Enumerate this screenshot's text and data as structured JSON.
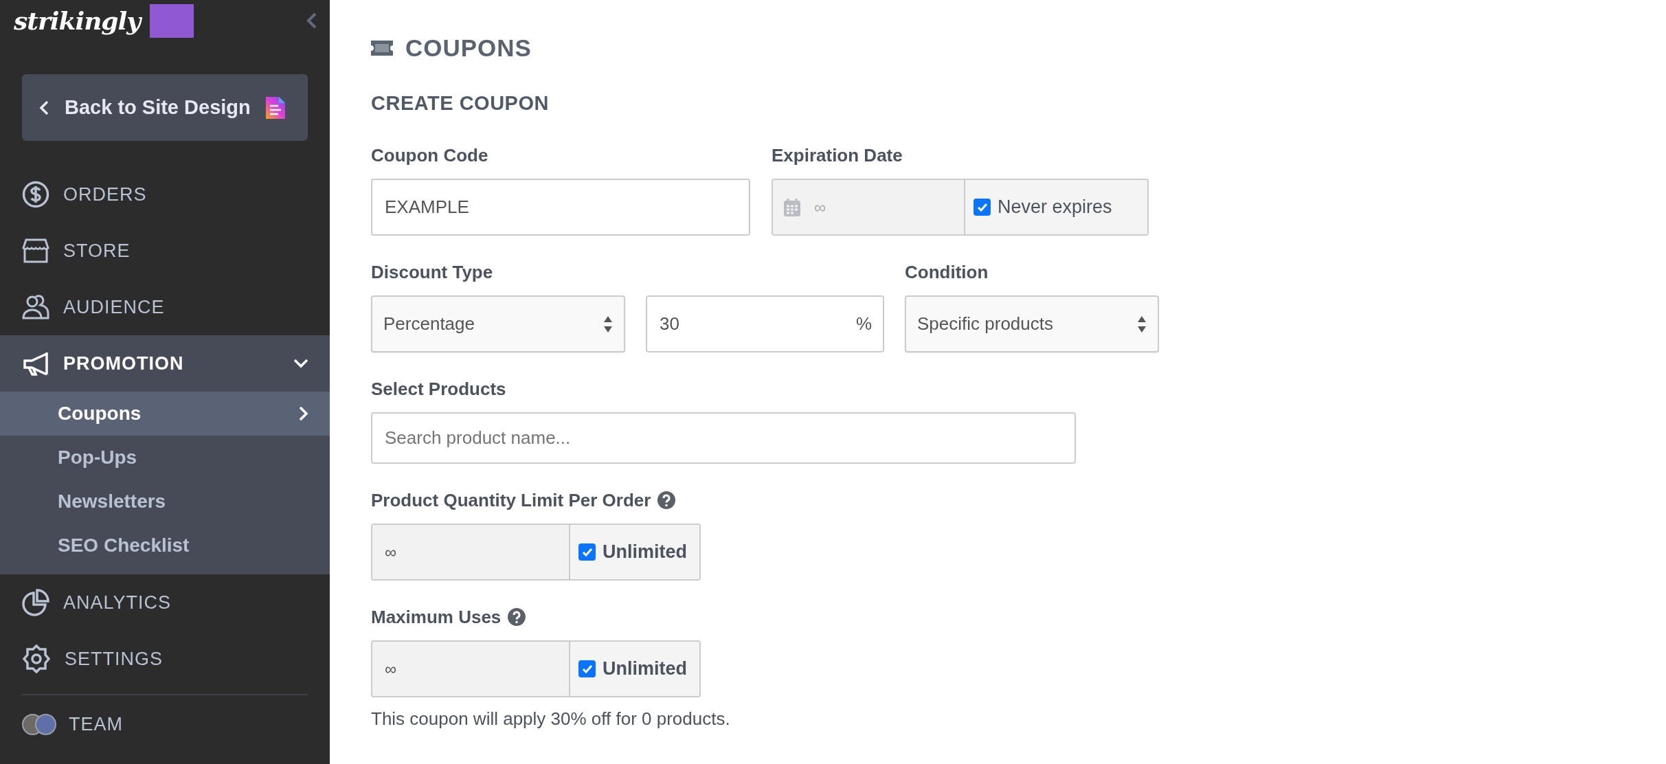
{
  "sidebar": {
    "logo": "strikingly",
    "back_button": "Back to Site Design",
    "nav": [
      {
        "label": "ORDERS"
      },
      {
        "label": "STORE"
      },
      {
        "label": "AUDIENCE"
      },
      {
        "label": "PROMOTION",
        "expanded": true,
        "children": [
          {
            "label": "Coupons",
            "selected": true
          },
          {
            "label": "Pop-Ups",
            "selected": false
          },
          {
            "label": "Newsletters",
            "selected": false
          },
          {
            "label": "SEO Checklist",
            "selected": false
          }
        ]
      },
      {
        "label": "ANALYTICS"
      },
      {
        "label": "SETTINGS"
      }
    ],
    "team": {
      "label": "TEAM"
    }
  },
  "page": {
    "title": "COUPONS",
    "section": "CREATE COUPON"
  },
  "form": {
    "coupon_code": {
      "label": "Coupon Code",
      "value": "EXAMPLE"
    },
    "expiration_date": {
      "label": "Expiration Date",
      "placeholder": "∞",
      "option": {
        "label": "Never expires",
        "checked": true
      }
    },
    "discount_type": {
      "label": "Discount Type",
      "value": "Percentage"
    },
    "discount_amount": {
      "value": "30",
      "unit": "%"
    },
    "condition": {
      "label": "Condition",
      "value": "Specific products"
    },
    "select_products": {
      "label": "Select Products",
      "placeholder": "Search product name..."
    },
    "quantity_limit": {
      "label": "Product Quantity Limit Per Order",
      "value": "∞",
      "option": {
        "label": "Unlimited",
        "checked": true
      }
    },
    "maximum_uses": {
      "label": "Maximum Uses",
      "value": "∞",
      "option": {
        "label": "Unlimited",
        "checked": true
      }
    },
    "summary": "This coupon will apply 30% off for 0 products."
  }
}
